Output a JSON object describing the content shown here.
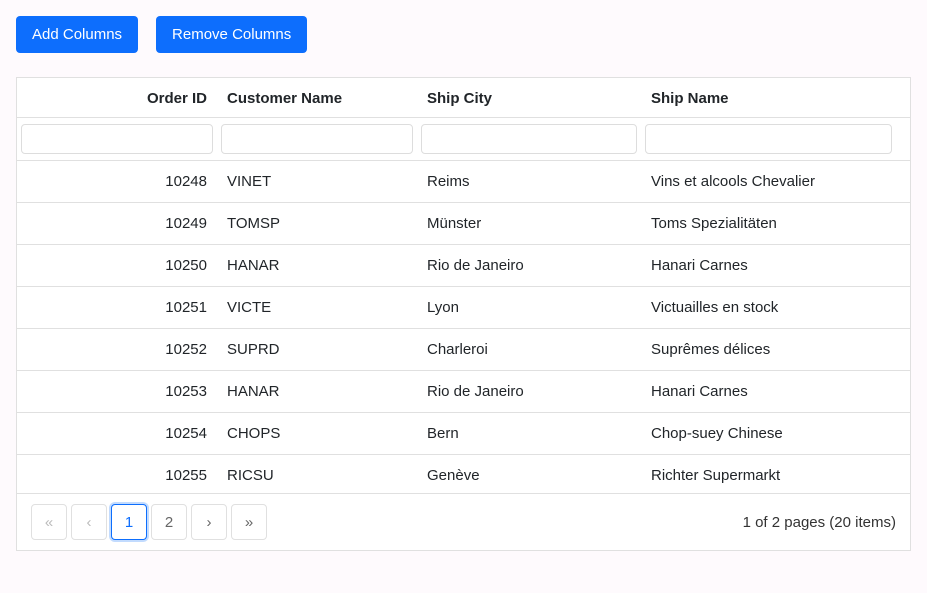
{
  "buttons": {
    "add": "Add Columns",
    "remove": "Remove Columns"
  },
  "columns": {
    "orderId": "Order ID",
    "customerName": "Customer Name",
    "shipCity": "Ship City",
    "shipName": "Ship Name"
  },
  "rows": [
    {
      "orderId": "10248",
      "customer": "VINET",
      "city": "Reims",
      "ship": "Vins et alcools Chevalier"
    },
    {
      "orderId": "10249",
      "customer": "TOMSP",
      "city": "Münster",
      "ship": "Toms Spezialitäten"
    },
    {
      "orderId": "10250",
      "customer": "HANAR",
      "city": "Rio de Janeiro",
      "ship": "Hanari Carnes"
    },
    {
      "orderId": "10251",
      "customer": "VICTE",
      "city": "Lyon",
      "ship": "Victuailles en stock"
    },
    {
      "orderId": "10252",
      "customer": "SUPRD",
      "city": "Charleroi",
      "ship": "Suprêmes délices"
    },
    {
      "orderId": "10253",
      "customer": "HANAR",
      "city": "Rio de Janeiro",
      "ship": "Hanari Carnes"
    },
    {
      "orderId": "10254",
      "customer": "CHOPS",
      "city": "Bern",
      "ship": "Chop-suey Chinese"
    },
    {
      "orderId": "10255",
      "customer": "RICSU",
      "city": "Genève",
      "ship": "Richter Supermarkt"
    }
  ],
  "pager": {
    "first": "«",
    "prev": "‹",
    "page1": "1",
    "page2": "2",
    "next": "›",
    "last": "»",
    "info": "1 of 2 pages (20 items)"
  }
}
